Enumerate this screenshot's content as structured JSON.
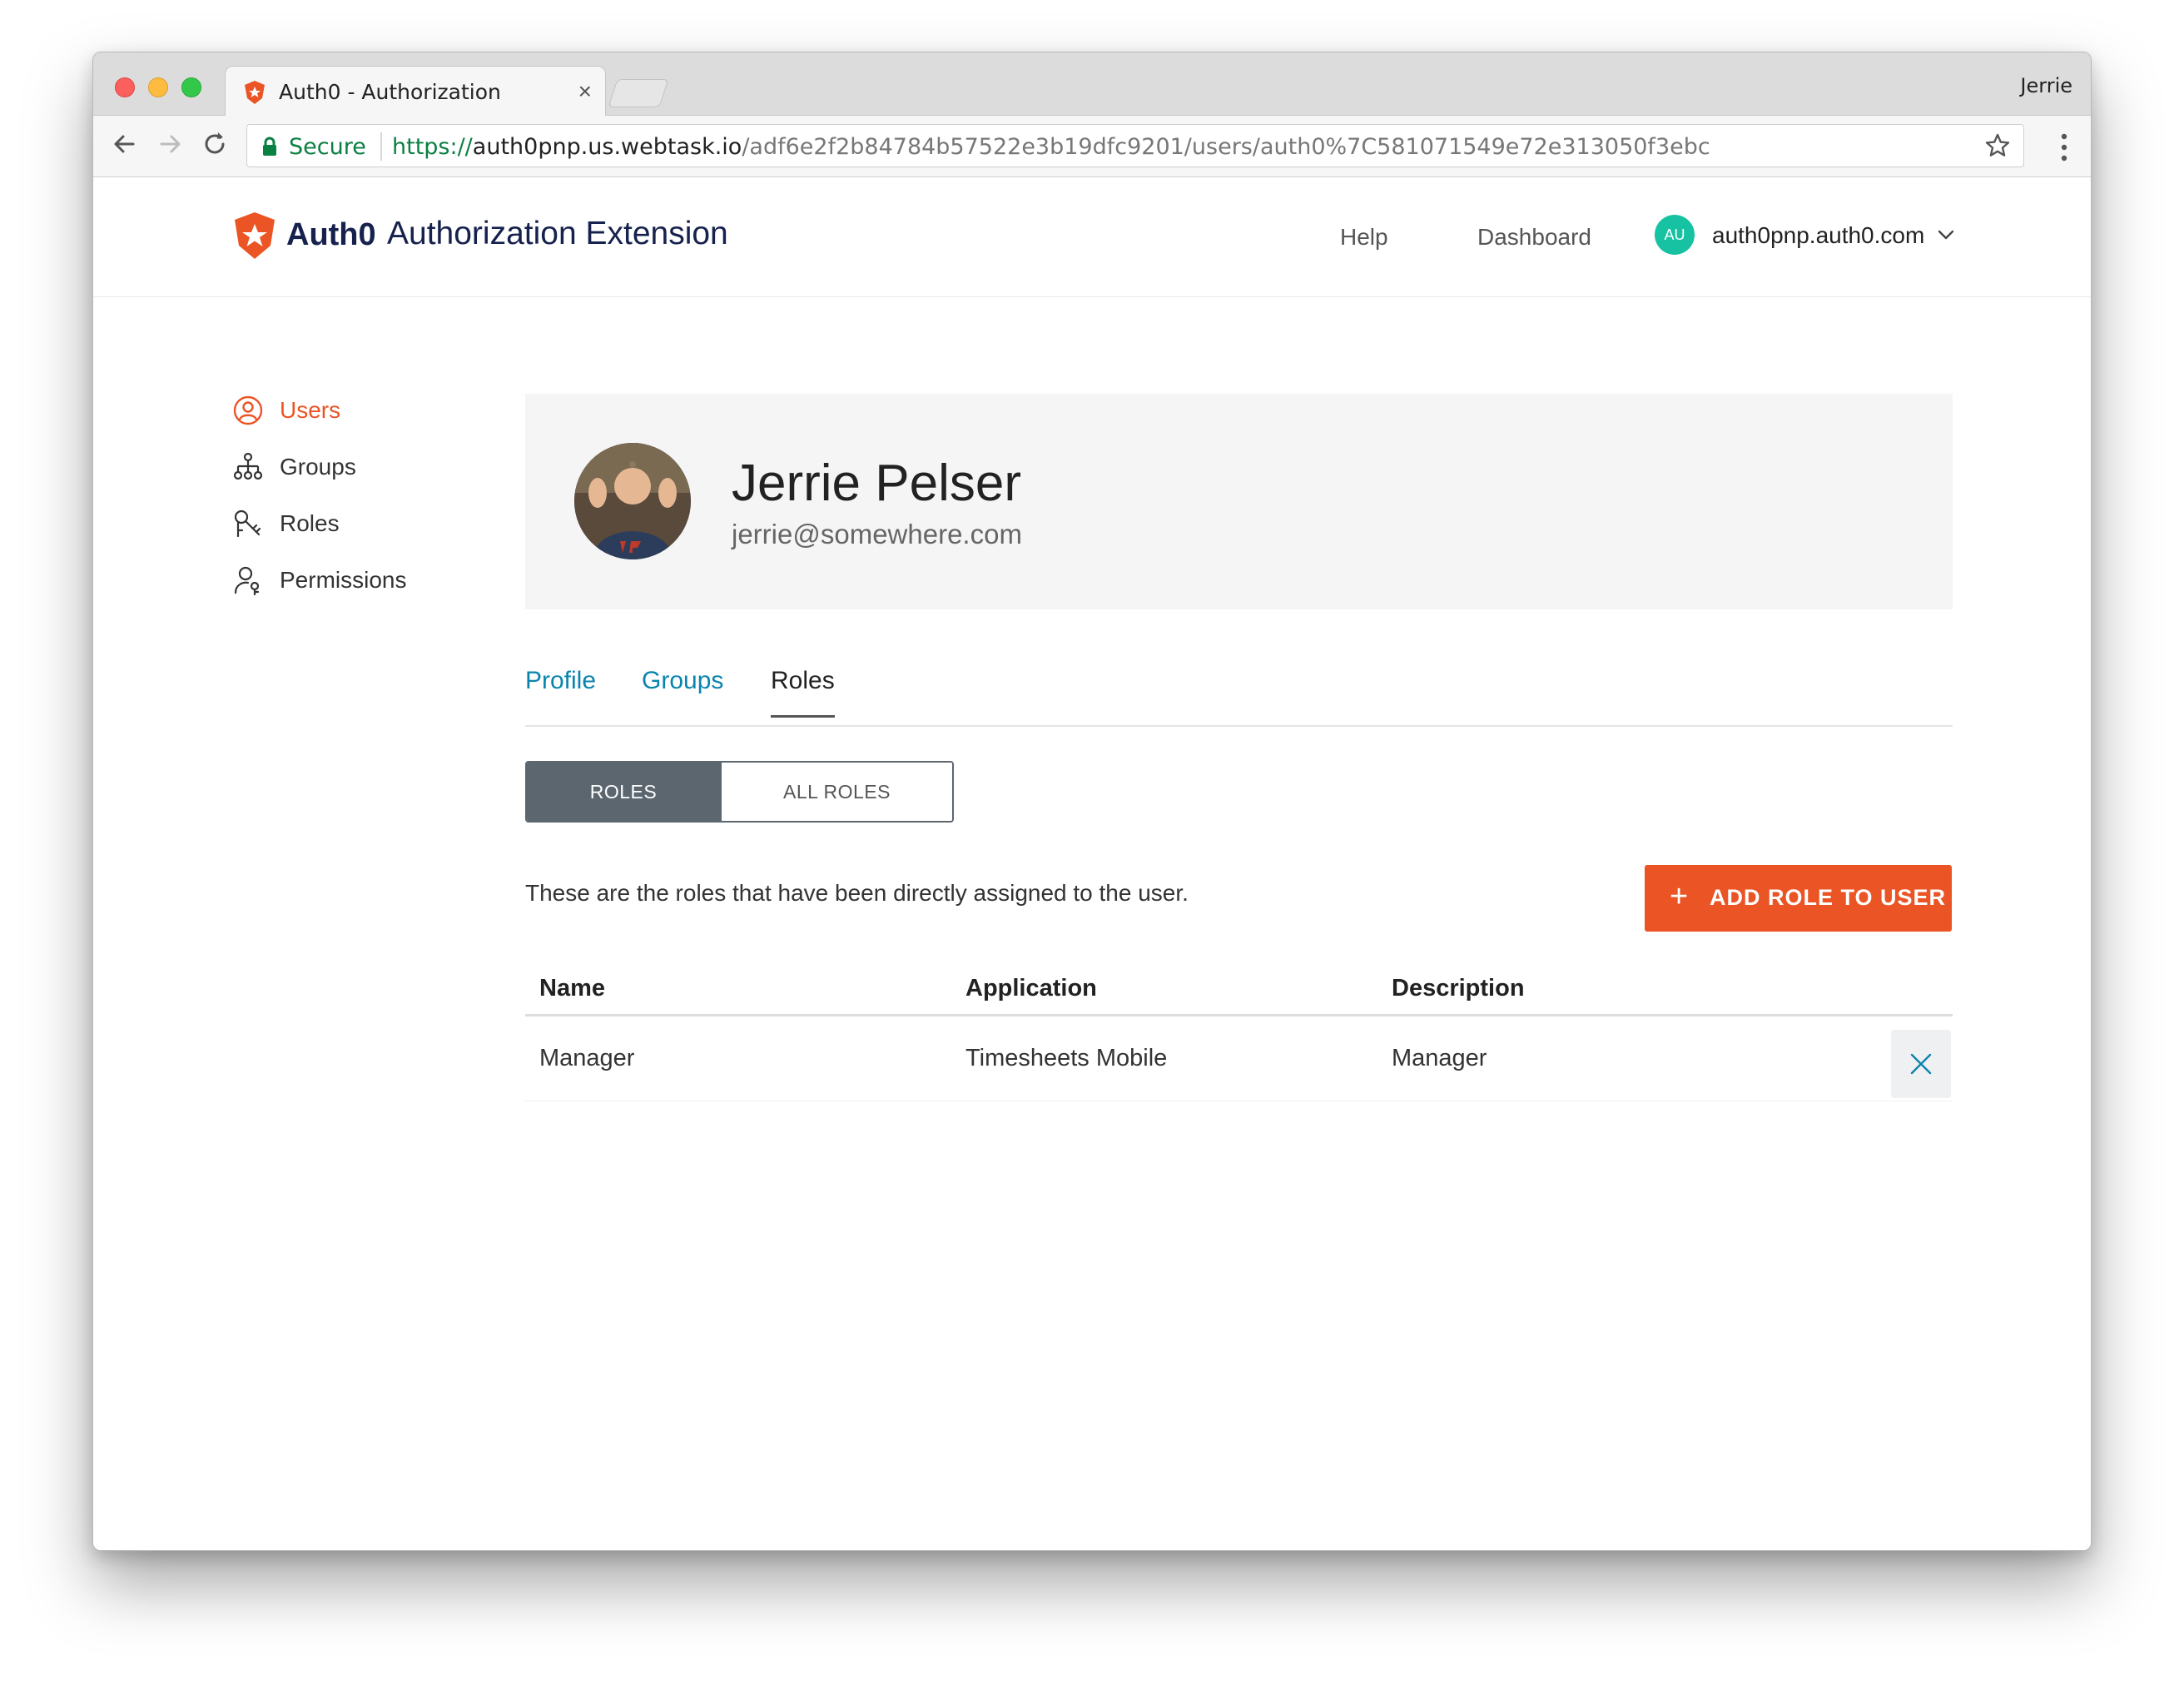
{
  "browser": {
    "tab_title": "Auth0 - Authorization",
    "tab_close": "×",
    "profile_name": "Jerrie",
    "secure_label": "Secure",
    "url_scheme": "https://",
    "url_host": "auth0pnp.us.webtask.io",
    "url_path": "/adf6e2f2b84784b57522e3b19dfc9201/users/auth0%7C581071549e72e313050f3ebc",
    "icons": [
      "back-icon",
      "forward-icon",
      "reload-icon",
      "lock-icon",
      "star-icon",
      "menu-icon"
    ]
  },
  "header": {
    "logo_text": "Auth0",
    "title": "Authorization Extension",
    "help": "Help",
    "dashboard": "Dashboard",
    "avatar_initials": "AU",
    "tenant": "auth0pnp.auth0.com"
  },
  "sidebar": {
    "items": [
      {
        "label": "Users",
        "icon": "user-circle-icon",
        "active": true
      },
      {
        "label": "Groups",
        "icon": "hierarchy-icon",
        "active": false
      },
      {
        "label": "Roles",
        "icon": "key-icon",
        "active": false
      },
      {
        "label": "Permissions",
        "icon": "user-key-icon",
        "active": false
      }
    ]
  },
  "user": {
    "name": "Jerrie Pelser",
    "email": "jerrie@somewhere.com"
  },
  "tabs": [
    {
      "label": "Profile",
      "active": false
    },
    {
      "label": "Groups",
      "active": false
    },
    {
      "label": "Roles",
      "active": true
    }
  ],
  "segmented": {
    "roles": "ROLES",
    "all_roles": "ALL ROLES",
    "selected": "ROLES"
  },
  "roles_section": {
    "description": "These are the roles that have been directly assigned to the user.",
    "add_button_icon": "+",
    "add_button_label": "ADD ROLE TO USER"
  },
  "table": {
    "columns": [
      "Name",
      "Application",
      "Description"
    ],
    "rows": [
      {
        "name": "Manager",
        "application": "Timesheets Mobile",
        "description": "Manager"
      }
    ]
  },
  "colors": {
    "accent": "#eb5424",
    "link": "#0a84ae",
    "segmented_active": "#5c666f",
    "avatar": "#16c2a1",
    "secure_green": "#0b8043"
  }
}
